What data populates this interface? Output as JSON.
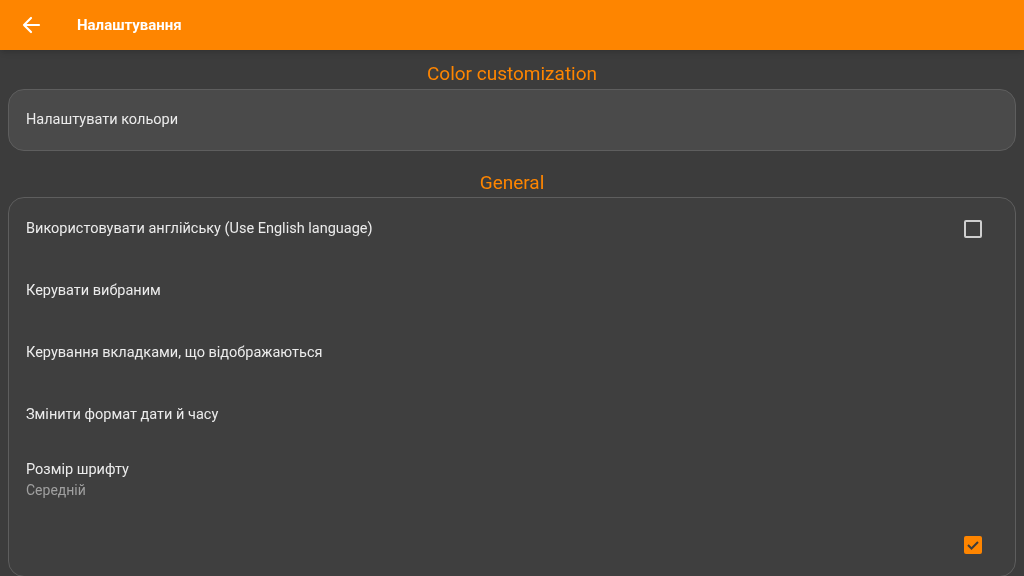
{
  "app_bar": {
    "title": "Налаштування"
  },
  "sections": [
    {
      "title": "Color customization",
      "kind": "tile",
      "items": [
        {
          "kind": "plain",
          "label": "Налаштувати кольори"
        }
      ]
    },
    {
      "title": "General",
      "kind": "list",
      "items": [
        {
          "kind": "checkbox",
          "label": "Використовувати англійську (Use English language)",
          "checked": false
        },
        {
          "kind": "plain",
          "label": "Керувати вибраним"
        },
        {
          "kind": "plain",
          "label": "Керування вкладками, що відображаються"
        },
        {
          "kind": "plain",
          "label": "Змінити формат дати й часу"
        },
        {
          "kind": "plain",
          "label": "Розмір шрифту",
          "summary": "Середній"
        },
        {
          "kind": "checkbox",
          "checked": true
        }
      ]
    }
  ]
}
